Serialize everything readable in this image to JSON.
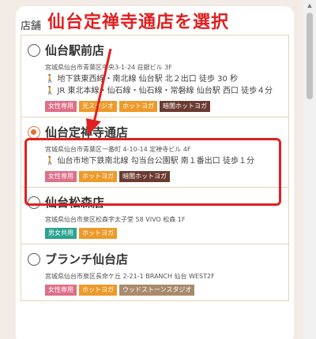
{
  "panel_title": "店舗",
  "annotation": "仙台定禅寺通店を選択",
  "stores": [
    {
      "name": "仙台駅前店",
      "address": "宮城県仙台市青葉区中央3-1-24 荘銀ビル 3F",
      "access": [
        "地下鉄東西線・南北線 仙台駅 北２出口 徒歩 30 秒",
        "JR 東北本線・仙石線・仙石線・常磐線 仙台駅 西口 徒歩４分"
      ],
      "tags": [
        "女性専用",
        "光スタジオ",
        "ホットヨガ",
        "暗闇ホットヨガ"
      ],
      "checked": false
    },
    {
      "name": "仙台定禅寺通店",
      "address": "宮城県仙台市青葉区一番町 4-10-14 定禅寺ビル 4F",
      "access": [
        "仙台市地下鉄南北線 勾当台公園駅 南１番出口 徒歩１分"
      ],
      "tags": [
        "女性専用",
        "ホットヨガ",
        "暗闇ホットヨガ"
      ],
      "checked": true
    },
    {
      "name": "仙台松森店",
      "address": "宮城県仙台市泉区松森字太子堂 58 VIVO 松森 1F",
      "access": [],
      "tags": [
        "男女共用",
        "ホットヨガ"
      ],
      "checked": false
    },
    {
      "name": "ブランチ仙台店",
      "address": "宮城県仙台市泉区長命ケ丘 2-21-1 BRANCH 仙台 WEST2F",
      "access": [],
      "tags": [
        "女性専用",
        "ホットヨガ",
        "ウッドストーンスタジオ"
      ],
      "checked": false
    }
  ],
  "colors": {
    "accent": "#e0703a",
    "annotation": "#e02020",
    "tag_pink": "#df6f88",
    "tag_orange": "#ed9a2a",
    "tag_brown": "#6b3a30",
    "tag_teal": "#2aa38f",
    "tag_tan": "#a98a6d"
  },
  "icons": {
    "walk": "walking-person-icon"
  }
}
